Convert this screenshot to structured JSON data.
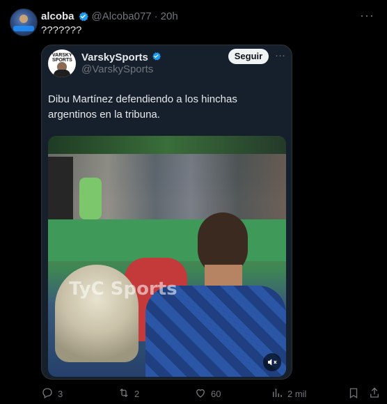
{
  "tweet": {
    "author_name": "alcoba",
    "author_handle": "@Alcoba077",
    "separator": "·",
    "time": "20h",
    "text": "???????"
  },
  "quote": {
    "name": "VarskySports",
    "handle": "@VarskySports",
    "follow_label": "Seguir",
    "text": "Dibu Martínez defendiendo a los hinchas argentinos en la tribuna.",
    "avatar_logo": "VARSKY SPORTS",
    "video_watermark": "TyC Sports"
  },
  "actions": {
    "replies": "3",
    "retweets": "2",
    "likes": "60",
    "views": "2 mil"
  },
  "colors": {
    "background": "#000000",
    "quote_background": "#16202c",
    "text": "#e7e9ea",
    "muted": "#71767b",
    "verified": "#1d9bf0"
  },
  "icons": [
    "verified-badge-icon",
    "more-icon",
    "mute-icon",
    "reply-icon",
    "retweet-icon",
    "like-icon",
    "views-icon",
    "bookmark-icon",
    "share-icon"
  ]
}
